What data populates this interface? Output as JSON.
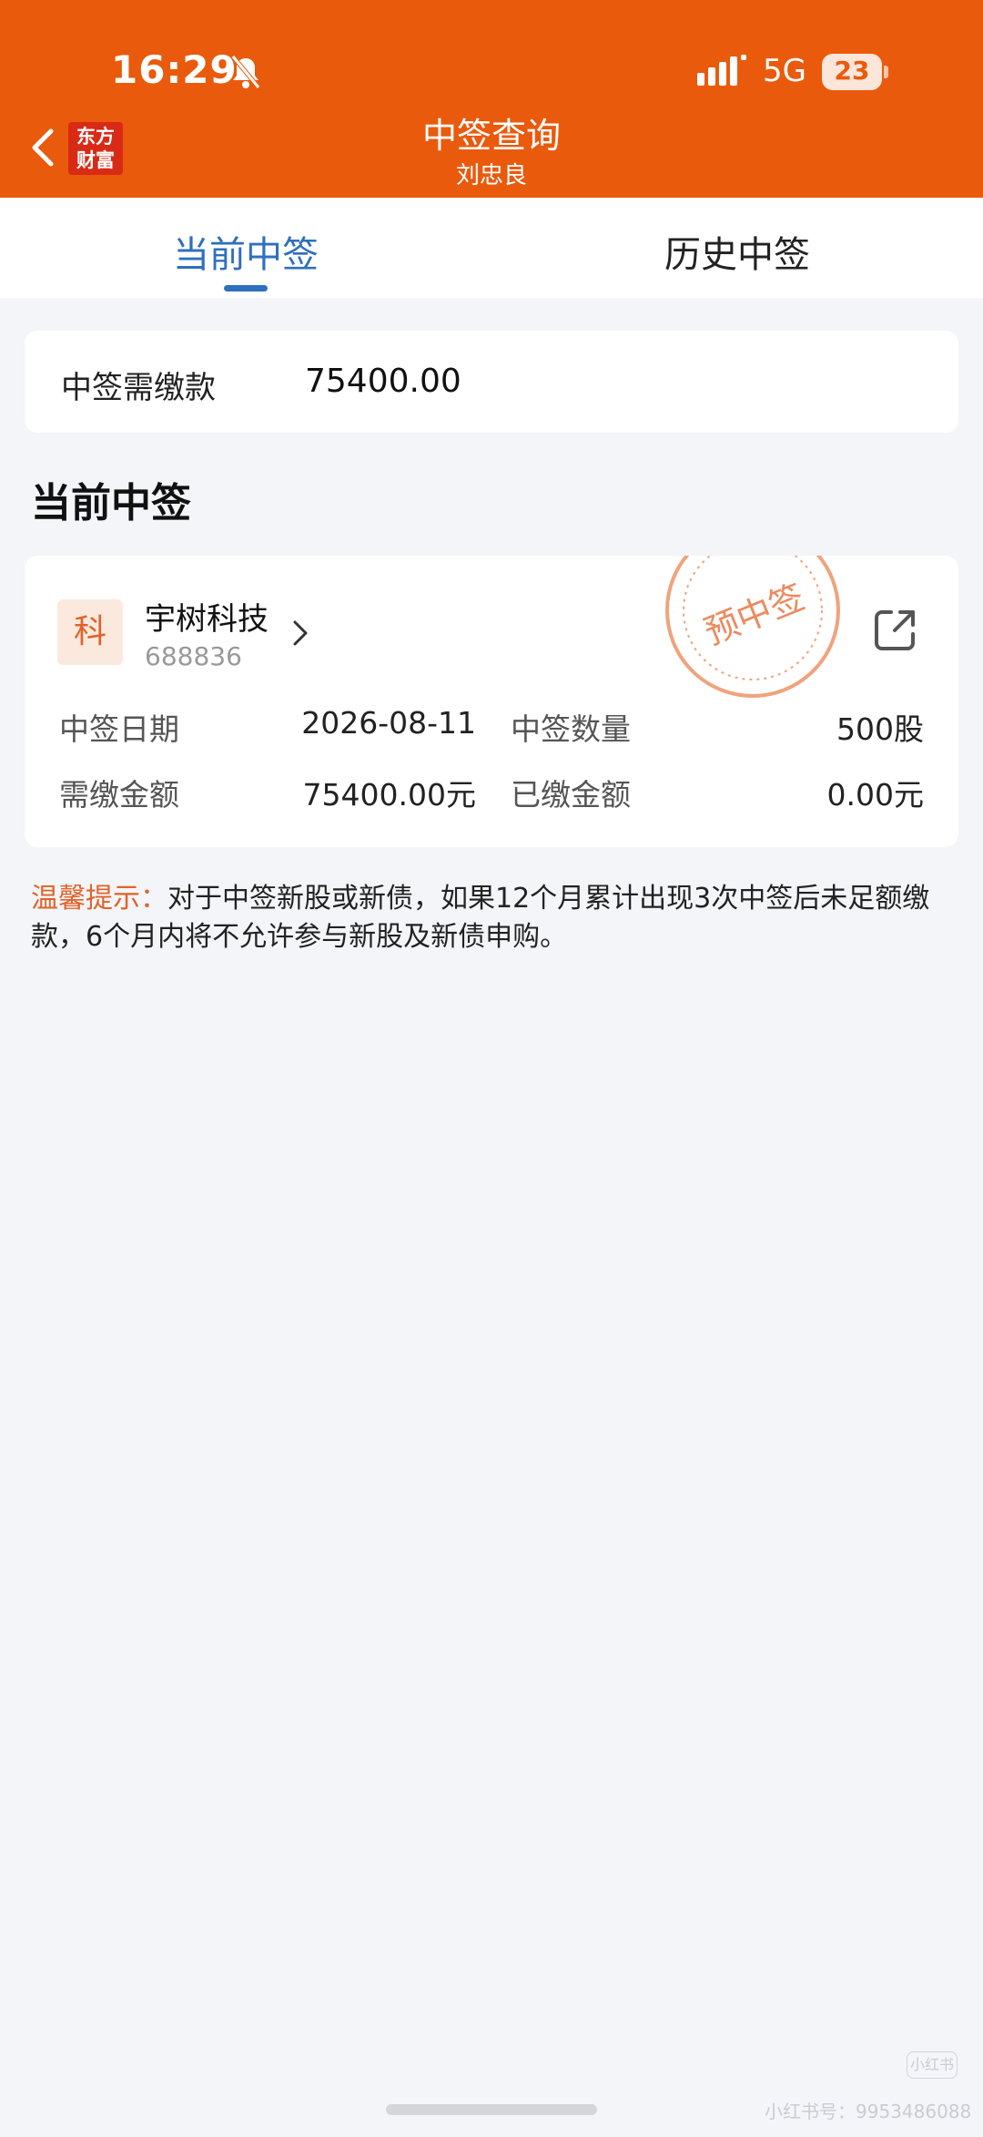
{
  "status_bar": {
    "time": "16:29",
    "network": "5G",
    "battery": "23",
    "icons": [
      "bell-muted-icon",
      "signal-icon",
      "battery-icon"
    ]
  },
  "nav": {
    "back_icon": "chevron-left-icon",
    "logo_line1": "东方",
    "logo_line2": "财富",
    "title": "中签查询",
    "subtitle": "刘忠良"
  },
  "tabs": [
    {
      "label": "当前中签",
      "active": true
    },
    {
      "label": "历史中签",
      "active": false
    }
  ],
  "due_summary": {
    "label": "中签需缴款",
    "value": "75400.00"
  },
  "section_title": "当前中签",
  "lot": {
    "board": "科",
    "name": "宇树科技",
    "code": "688836",
    "stamp": "预中签",
    "share_icon": "external-link-icon",
    "fields": [
      {
        "label": "中签日期",
        "value": "2026-08-11"
      },
      {
        "label": "中签数量",
        "value": "500股"
      },
      {
        "label": "需缴金额",
        "value": "75400.00元"
      },
      {
        "label": "已缴金额",
        "value": "0.00元"
      }
    ]
  },
  "tip": {
    "label": "温馨提示：",
    "text": "对于中签新股或新债，如果12个月累计出现3次中签后未足额缴款，6个月内将不允许参与新股及新债申购。"
  },
  "watermark": {
    "badge": "小红书",
    "text": "小红书号：9953486088"
  },
  "colors": {
    "brand": "#ea5a0c",
    "accent_blue": "#2f6fbf",
    "logo_red": "#d92a15",
    "tip_orange": "#e1622a",
    "background": "#f3f5f8"
  }
}
